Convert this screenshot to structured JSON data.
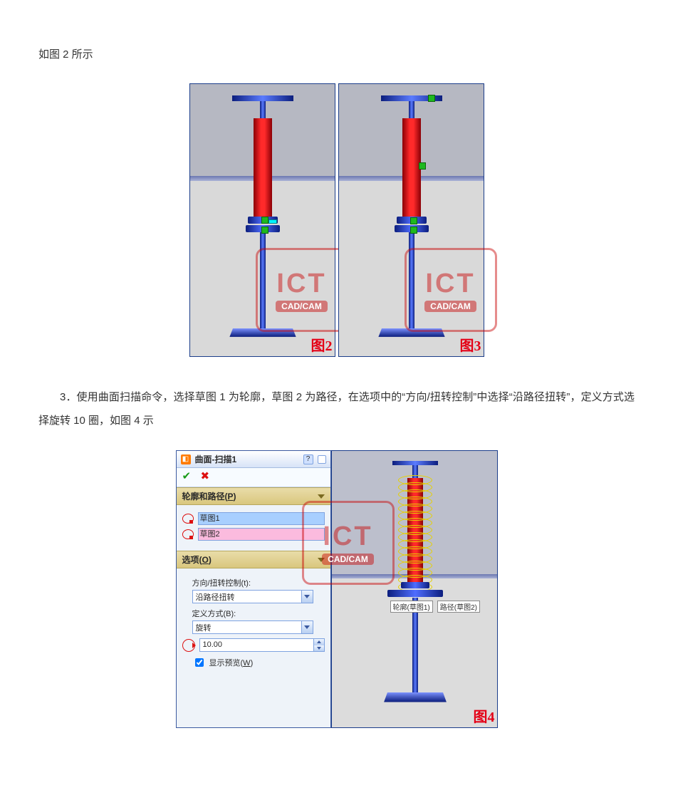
{
  "text": {
    "p1": "如图 2 所示",
    "p2": "3．使用曲面扫描命令，选择草图 1 为轮廓，草图 2 为路径，在选项中的“方向/扭转控制”中选择“沿路径扭转”，定义方式选择旋转 10 圈，如图 4 示"
  },
  "figure_labels": {
    "fig2": "图2",
    "fig3": "图3",
    "fig4": "图4"
  },
  "watermark": {
    "main": "ICT",
    "sub": "CAD/CAM"
  },
  "panel": {
    "title": "曲面-扫描1",
    "section_profile": {
      "header": "轮廓和路径",
      "hotkey": "P"
    },
    "profile_row": "草图1",
    "path_row": "草图2",
    "section_options": {
      "header": "选项",
      "hotkey": "O"
    },
    "direction_label": "方向/扭转控制(t):",
    "direction_value": "沿路径扭转",
    "define_label": "定义方式(B):",
    "define_value": "旋转",
    "spin_value": "10.00",
    "preview_label": "显示预览",
    "preview_hotkey": "W"
  },
  "flags": {
    "profile": "轮廓(草图1)",
    "path": "路径(草图2)"
  }
}
